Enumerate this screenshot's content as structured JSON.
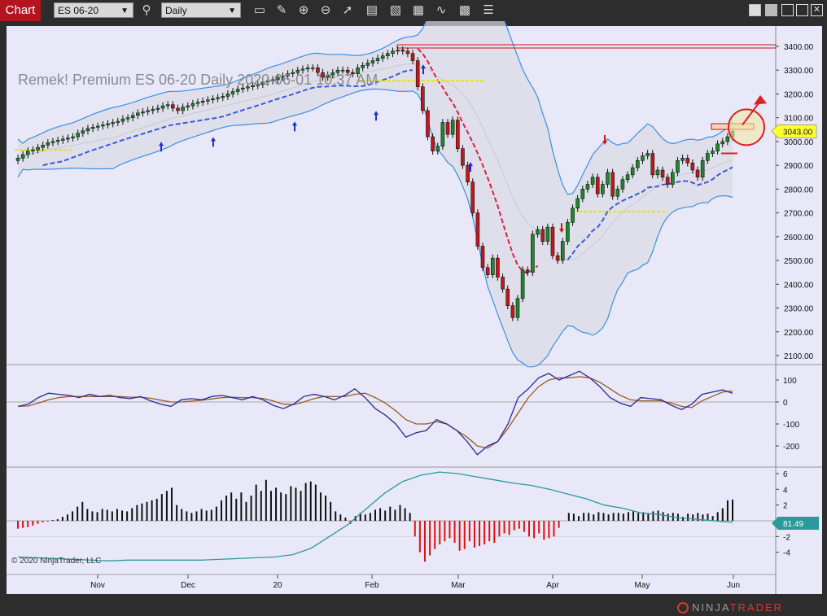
{
  "toolbar": {
    "chart_tab": "Chart",
    "instrument": "ES 06-20",
    "interval": "Daily",
    "icons": [
      "search-icon",
      "bar-type-icon",
      "draw-pencil-icon",
      "zoom-in-icon",
      "zoom-out-icon",
      "pointer-icon",
      "data-box-icon",
      "properties-icon",
      "strategies-icon",
      "indicators-icon",
      "list-icon"
    ]
  },
  "window_controls": [
    "link-icon",
    "gray-square-icon",
    "minimize-icon",
    "maximize-icon",
    "close-icon"
  ],
  "chart_data": {
    "type": "candlestick",
    "title": "Remek!  Premium  ES 06-20  Daily  2020-06-01 10:37 AM",
    "copyright": "© 2020 NinjaTrader, LLC",
    "x_labels": [
      "Nov",
      "Dec",
      "20",
      "Feb",
      "Mar",
      "Apr",
      "May",
      "Jun"
    ],
    "price_panel": {
      "y_ticks": [
        2100,
        2200,
        2300,
        2400,
        2500,
        2600,
        2700,
        2800,
        2900,
        3000,
        3100,
        3200,
        3300,
        3400
      ],
      "last_price_label": "3043.00",
      "last_price": 3043,
      "close": [
        2930,
        2945,
        2960,
        2965,
        2975,
        2985,
        2995,
        3000,
        3005,
        3010,
        3015,
        3020,
        3035,
        3045,
        3055,
        3060,
        3065,
        3070,
        3075,
        3080,
        3085,
        3095,
        3100,
        3110,
        3120,
        3125,
        3130,
        3135,
        3140,
        3150,
        3155,
        3140,
        3130,
        3145,
        3150,
        3160,
        3165,
        3170,
        3175,
        3180,
        3185,
        3190,
        3200,
        3210,
        3220,
        3225,
        3230,
        3235,
        3240,
        3250,
        3255,
        3260,
        3270,
        3275,
        3285,
        3290,
        3300,
        3305,
        3310,
        3310,
        3290,
        3270,
        3280,
        3290,
        3300,
        3300,
        3290,
        3285,
        3310,
        3320,
        3330,
        3340,
        3350,
        3360,
        3370,
        3380,
        3385,
        3380,
        3370,
        3340,
        3230,
        3130,
        3020,
        2960,
        2980,
        3080,
        3030,
        3090,
        2970,
        2900,
        2830,
        2700,
        2560,
        2470,
        2440,
        2510,
        2430,
        2380,
        2310,
        2260,
        2340,
        2460,
        2450,
        2610,
        2630,
        2580,
        2640,
        2520,
        2500,
        2580,
        2660,
        2720,
        2760,
        2800,
        2820,
        2850,
        2780,
        2820,
        2870,
        2770,
        2800,
        2840,
        2860,
        2890,
        2920,
        2940,
        2950,
        2860,
        2880,
        2850,
        2820,
        2870,
        2920,
        2930,
        2910,
        2880,
        2850,
        2920,
        2950,
        2960,
        2990,
        3000,
        3020,
        3043
      ],
      "lines": {
        "red_hline_top": 3400,
        "yellow_hline_left": 2965,
        "yellow_hline_feb": 3255,
        "yellow_hline_apr": 2705,
        "target_box_price": 3065
      }
    },
    "osc_panel": {
      "y_ticks": [
        100,
        0,
        -100,
        -200
      ],
      "fast": [
        -20,
        -10,
        20,
        40,
        35,
        30,
        20,
        35,
        25,
        30,
        20,
        15,
        25,
        5,
        -10,
        -20,
        10,
        15,
        10,
        25,
        30,
        20,
        10,
        25,
        10,
        -15,
        -30,
        -10,
        25,
        35,
        25,
        10,
        30,
        60,
        20,
        -30,
        -60,
        -100,
        -160,
        -140,
        -130,
        -80,
        -100,
        -130,
        -180,
        -240,
        -200,
        -180,
        -100,
        20,
        60,
        110,
        130,
        100,
        120,
        140,
        110,
        70,
        20,
        -5,
        -20,
        20,
        15,
        10,
        -15,
        -35,
        -10,
        35,
        45,
        55,
        40
      ],
      "slow": [
        -20,
        -18,
        -5,
        10,
        20,
        25,
        25,
        25,
        25,
        25,
        25,
        22,
        22,
        17,
        8,
        0,
        0,
        4,
        8,
        14,
        20,
        22,
        20,
        20,
        16,
        5,
        -10,
        -12,
        0,
        15,
        25,
        25,
        25,
        35,
        40,
        20,
        -5,
        -40,
        -80,
        -100,
        -100,
        -90,
        -100,
        -130,
        -160,
        -200,
        -210,
        -180,
        -120,
        -50,
        20,
        70,
        100,
        110,
        110,
        115,
        110,
        90,
        60,
        30,
        10,
        5,
        5,
        5,
        -5,
        -20,
        -25,
        5,
        25,
        45,
        50
      ],
      "gray_line": 0
    },
    "vol_panel": {
      "y_ticks": [
        6,
        4,
        2,
        0,
        -2,
        -4
      ],
      "last_value_label": "81.49",
      "hist": [
        -1.0,
        -0.9,
        -0.8,
        -0.6,
        -0.4,
        -0.2,
        -0.1,
        0.1,
        0.2,
        0.5,
        0.8,
        1.2,
        1.8,
        2.4,
        1.5,
        1.2,
        1.1,
        1.5,
        1.4,
        1.2,
        1.5,
        1.3,
        1.2,
        1.6,
        2.0,
        2.2,
        2.4,
        2.6,
        2.8,
        3.4,
        3.8,
        4.2,
        2.0,
        1.5,
        1.2,
        1.0,
        1.2,
        1.5,
        1.3,
        1.4,
        1.8,
        2.6,
        3.2,
        3.6,
        2.8,
        3.6,
        2.4,
        3.2,
        4.6,
        3.8,
        5.2,
        3.8,
        4.2,
        3.6,
        3.4,
        4.4,
        4.2,
        3.8,
        4.8,
        5.0,
        4.6,
        3.6,
        3.2,
        2.4,
        1.2,
        0.8,
        0.4,
        -0.4,
        0.6,
        1.0,
        0.8,
        1.0,
        1.4,
        1.6,
        1.3,
        1.8,
        1.4,
        2.0,
        1.6,
        1.0,
        -2.0,
        -4.0,
        -5.2,
        -4.4,
        -3.6,
        -3.0,
        -2.6,
        -2.2,
        -2.8,
        -3.8,
        -3.6,
        -2.6,
        -3.4,
        -3.2,
        -3.0,
        -2.6,
        -2.8,
        -2.0,
        -1.6,
        -1.8,
        -1.2,
        -1.0,
        -1.4,
        -2.0,
        -2.2,
        -1.6,
        -2.4,
        -2.2,
        -2.0,
        -0.9,
        0.0,
        1.0,
        0.9,
        0.6,
        1.0,
        1.0,
        0.8,
        1.1,
        1.0,
        0.8,
        1.0,
        1.0,
        0.9,
        1.1,
        1.2,
        1.0,
        1.1,
        0.9,
        1.2,
        1.3,
        1.1,
        0.9,
        1.0,
        0.9,
        0.5,
        0.9,
        0.8,
        1.0,
        0.8,
        0.9,
        0.6,
        1.1,
        1.6,
        2.6,
        2.7
      ],
      "line": [
        -4.6,
        -4.7,
        -4.8,
        -4.9,
        -5.0,
        -5.1,
        -5.0,
        -5.0,
        -5.0,
        -5.0,
        -5.0,
        -4.9,
        -4.8,
        -4.7,
        -4.6,
        -4.3,
        -3.5,
        -2.0,
        -0.5,
        1.5,
        3.5,
        5.0,
        5.8,
        6.2,
        6.0,
        5.6,
        5.2,
        4.8,
        4.5,
        4.0,
        3.4,
        2.8,
        2.0,
        1.6,
        1.0,
        0.8,
        0.4,
        0.2,
        0.0,
        -0.2
      ]
    }
  }
}
